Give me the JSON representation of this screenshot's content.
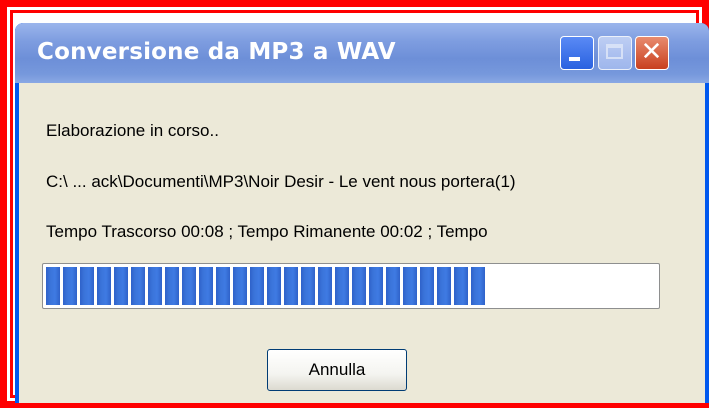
{
  "window": {
    "title": "Conversione da MP3 a WAV",
    "close_glyph": "✕"
  },
  "status": {
    "line1": "Elaborazione in corso..",
    "line2": "C:\\ ... ack\\Documenti\\MP3\\Noir Desir - Le vent nous portera(1)",
    "line3": "Tempo Trascorso 00:08 ; Tempo Rimanente 00:02 ; Tempo"
  },
  "progress": {
    "fraction": 0.73
  },
  "buttons": {
    "cancel": "Annulla"
  },
  "icons": {
    "minimize": "minimize-icon",
    "maximize": "maximize-icon",
    "close": "close-icon"
  },
  "colors": {
    "title_bar": "#7e9de0",
    "progress": "#3f7be3",
    "dialog_bg": "#ece9d8",
    "annotation_border": "#ff0000"
  }
}
